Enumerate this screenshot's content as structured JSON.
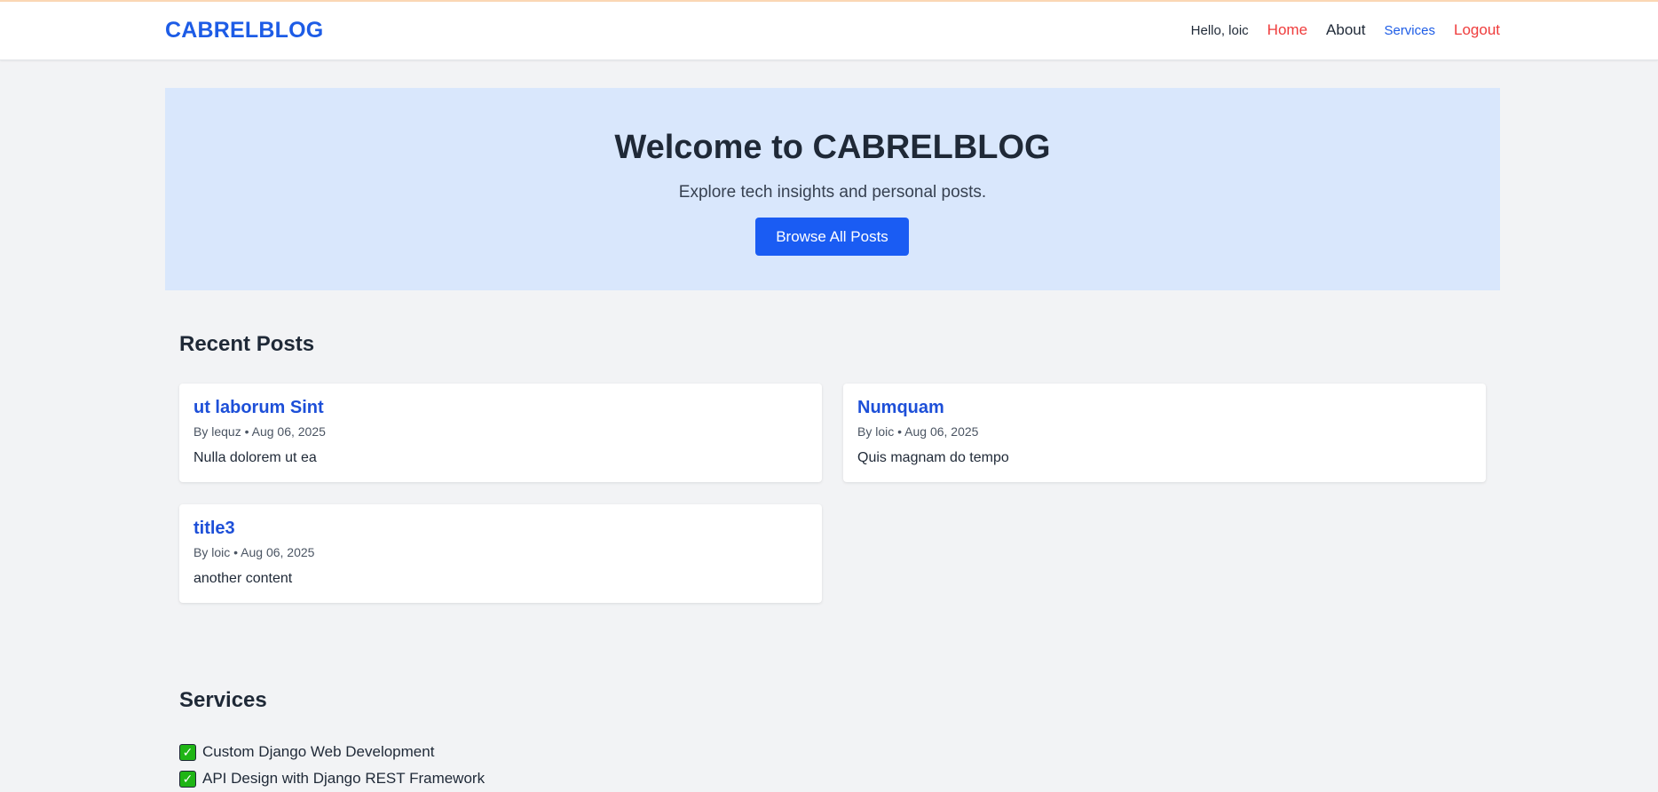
{
  "header": {
    "brand": "CABRELBLOG",
    "greeting": "Hello, loic",
    "nav": {
      "home": "Home",
      "about": "About",
      "services": "Services",
      "logout": "Logout"
    }
  },
  "hero": {
    "title": "Welcome to CABRELBLOG",
    "subtitle": "Explore tech insights and personal posts.",
    "button_label": "Browse All Posts"
  },
  "recent_posts": {
    "heading": "Recent Posts",
    "posts": [
      {
        "title": "ut laborum Sint",
        "meta": "By lequz • Aug 06, 2025",
        "excerpt": "Nulla dolorem ut ea"
      },
      {
        "title": "Numquam",
        "meta": "By loic • Aug 06, 2025",
        "excerpt": "Quis magnam do tempo"
      },
      {
        "title": "title3",
        "meta": "By loic • Aug 06, 2025",
        "excerpt": "another content"
      }
    ]
  },
  "services": {
    "heading": "Services",
    "items": [
      {
        "icon": "check-icon",
        "label": "Custom Django Web Development"
      },
      {
        "icon": "check-icon",
        "label": "API Design with Django REST Framework"
      }
    ]
  },
  "colors": {
    "brand": "#1d5ce6",
    "accent_red": "#ef3b3b",
    "hero_bg": "#d9e7fc",
    "button": "#1a5cf3",
    "page_bg": "#f2f3f5"
  }
}
